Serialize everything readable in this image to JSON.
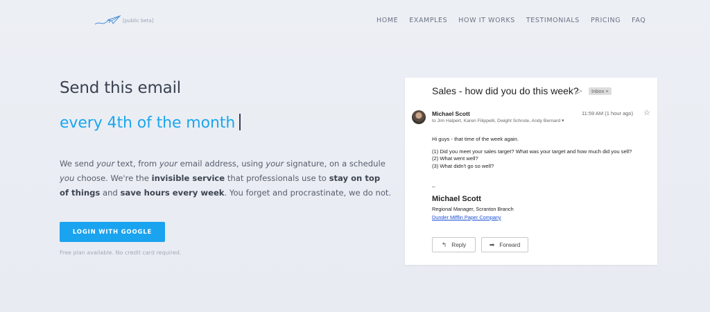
{
  "logo": {
    "beta": "[public beta]"
  },
  "nav": [
    "HOME",
    "EXAMPLES",
    "HOW IT WORKS",
    "TESTIMONIALS",
    "PRICING",
    "FAQ"
  ],
  "hero": {
    "headline": "Send this email",
    "rotating": "every 4th of the month",
    "desc": {
      "we_send": "We send ",
      "your1": "your",
      "from": " text, from ",
      "your2": "your",
      "email_addr": " email address, using ",
      "your3": "your",
      "signature": " signature, on a schedule",
      "you": "you",
      "choose": " choose. We're the ",
      "invisible": "invisible service",
      "that": " that professionals use to ",
      "stay1": "stay on top",
      "stay2": "of things",
      "and": " and ",
      "save": "save hours every week",
      "end": ". You forget and procrastinate, we do not."
    },
    "login_label": "LOGIN WITH GOOGLE",
    "free_note": "Free plan available. No credit card required."
  },
  "email": {
    "subject": "Sales - how did you do this week?",
    "label_chip": "Inbox ×",
    "sender": "Michael Scott",
    "time": "11:59 AM (1 hour ago)",
    "recipients": "to Jim Halpert, Karen Filippelli, Dwight Schrute, Andy Bernard ▾",
    "greeting": "Hi guys - that time of the week again.",
    "lines": [
      "(1) Did you meet your sales target? What was your target and how much did you sell?",
      "(2) What went well?",
      "(3) What didn't go so well?"
    ],
    "sig_dash": "--",
    "sig_name": "Michael Scott",
    "sig_title": "Regional Manager, Scranton Branch",
    "sig_company": "Dunder Mifflin Paper Company",
    "reply_label": "Reply",
    "forward_label": "Forward"
  },
  "colors": {
    "accent": "#1aa3ef",
    "headline": "#3a4150",
    "link": "#1a4fd6"
  },
  "icons": [
    "paper-plane-logo-icon",
    "label-arrow-icon",
    "star-icon",
    "reply-arrow-icon",
    "forward-arrow-icon"
  ]
}
